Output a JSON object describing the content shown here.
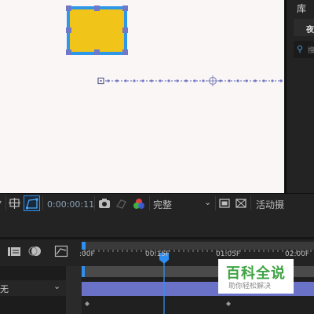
{
  "right_panel": {
    "title": "库",
    "tab_label": "夜",
    "search_placeholder": "搜"
  },
  "viewer_toolbar": {
    "timecode": "0:00:00:11",
    "resolution": "完整",
    "active_camera": "活动摄"
  },
  "timeline": {
    "ruler_ticks": [
      ":00F",
      "00:15F",
      "01:05F",
      "02:00F"
    ],
    "layer_mode": "无"
  },
  "watermark": {
    "main": "百科全说",
    "sub": "助你轻松解决"
  },
  "colors": {
    "shape_fill": "#f0c419",
    "shape_stroke": "#2f97e8",
    "selection_handle": "#6f78c9",
    "playhead": "#2f8ff0",
    "track_bar": "#6a72c8",
    "watermark_green": "#3fa344"
  },
  "icons": {
    "region_of_interest": "region-of-interest-icon",
    "snapshot": "camera-icon",
    "show_channel": "color-channels-icon",
    "draft_3d": "box-icon"
  }
}
